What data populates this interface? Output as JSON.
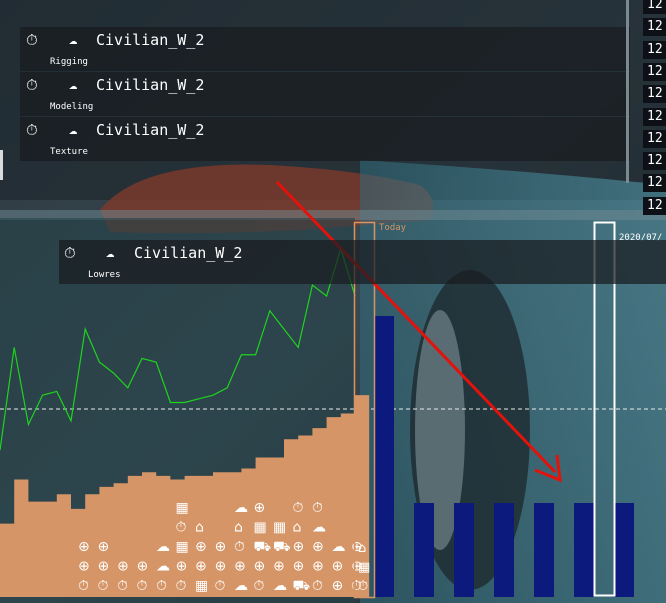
{
  "colors": {
    "accent": "#d59566",
    "line": "#1fd31f",
    "bars": "#0d1a7d",
    "arrow": "#e3120b"
  },
  "task_rows": [
    {
      "task": "Civilian_W_2",
      "step": "Rigging"
    },
    {
      "task": "Civilian_W_2",
      "step": "Modeling"
    },
    {
      "task": "Civilian_W_2",
      "step": "Texture"
    }
  ],
  "floating_row": {
    "task": "Civilian_W_2",
    "step": "Lowres"
  },
  "right_column": {
    "values": [
      "12",
      "12",
      "12",
      "12",
      "12",
      "12",
      "12",
      "12",
      "12",
      "12"
    ]
  },
  "timeline": {
    "today_label": "Today",
    "date_label": "2020/07/"
  },
  "icons": {
    "timer": "stopwatch-icon",
    "asset": "brain-icon"
  },
  "chart_data": {
    "type": "area",
    "line_values": [
      40,
      68,
      47,
      55,
      56,
      48,
      73,
      64,
      61,
      57,
      65,
      64,
      53,
      53,
      54,
      55,
      57,
      66,
      66,
      78,
      73,
      68,
      85,
      82,
      95,
      82
    ],
    "area_values": [
      20,
      32,
      26,
      26,
      28,
      24,
      28,
      30,
      31,
      33,
      34,
      33,
      32,
      33,
      33,
      34,
      34,
      35,
      38,
      38,
      43,
      44,
      46,
      49,
      50,
      55
    ],
    "ylim": [
      0,
      100
    ]
  },
  "stacked_icons": {
    "columns": [
      [
        "timer",
        "bullseye",
        "bullseye"
      ],
      [
        "timer",
        "bullseye",
        "bullseye"
      ],
      [
        "timer",
        "bullseye"
      ],
      [
        "timer",
        "bullseye"
      ],
      [
        "timer",
        "brain",
        "brain"
      ],
      [
        "timer",
        "bullseye",
        "clapper",
        "timer",
        "clapper"
      ],
      [
        "clapper",
        "bullseye",
        "bullseye",
        "home"
      ],
      [
        "timer",
        "bullseye",
        "bullseye"
      ],
      [
        "brain",
        "bullseye",
        "timer",
        "home",
        "brain"
      ],
      [
        "timer",
        "bullseye",
        "car",
        "clapper",
        "bullseye"
      ],
      [
        "brain",
        "bullseye",
        "car",
        "clapper"
      ],
      [
        "car",
        "bullseye",
        "bullseye",
        "home",
        "timer"
      ],
      [
        "timer",
        "bullseye",
        "bullseye",
        "brain",
        "timer"
      ],
      [
        "bullseye",
        "bullseye",
        "brain"
      ],
      [
        "timer",
        "bullseye",
        "bullseye"
      ]
    ]
  }
}
